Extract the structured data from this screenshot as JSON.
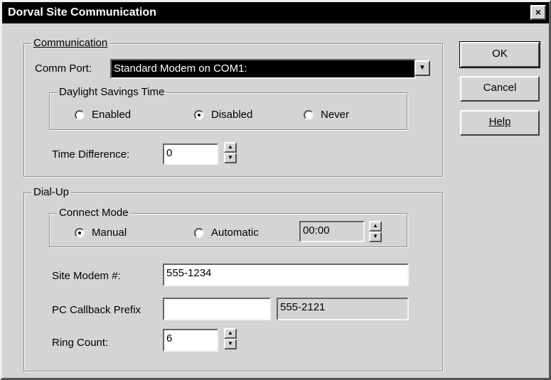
{
  "window": {
    "title": "Dorval  Site Communication",
    "close_glyph": "×"
  },
  "communication": {
    "group_label": "Communication",
    "comm_port_label": "Comm Port:",
    "comm_port_value": "Standard Modem on COM1:",
    "dst": {
      "group_label": "Daylight Savings Time",
      "options": [
        "Enabled",
        "Disabled",
        "Never"
      ],
      "selected": "Disabled"
    },
    "time_difference_label": "Time Difference:",
    "time_difference_value": "0"
  },
  "dialup": {
    "group_label": "Dial-Up",
    "connect_mode": {
      "group_label": "Connect Mode",
      "options": [
        "Manual",
        "Automatic"
      ],
      "selected": "Manual",
      "time_value": "00:00"
    },
    "site_modem_label": "Site Modem #:",
    "site_modem_value": "555-1234",
    "pc_callback_label": "PC Callback Prefix",
    "pc_callback_value": "",
    "pc_callback_number": "555-2121",
    "ring_count_label": "Ring Count:",
    "ring_count_value": "6"
  },
  "buttons": {
    "ok": "OK",
    "cancel": "Cancel",
    "help": "Help"
  },
  "icons": {
    "dropdown": "chevron-down-icon",
    "spin_up": "spin-up-icon",
    "spin_down": "spin-down-icon"
  }
}
